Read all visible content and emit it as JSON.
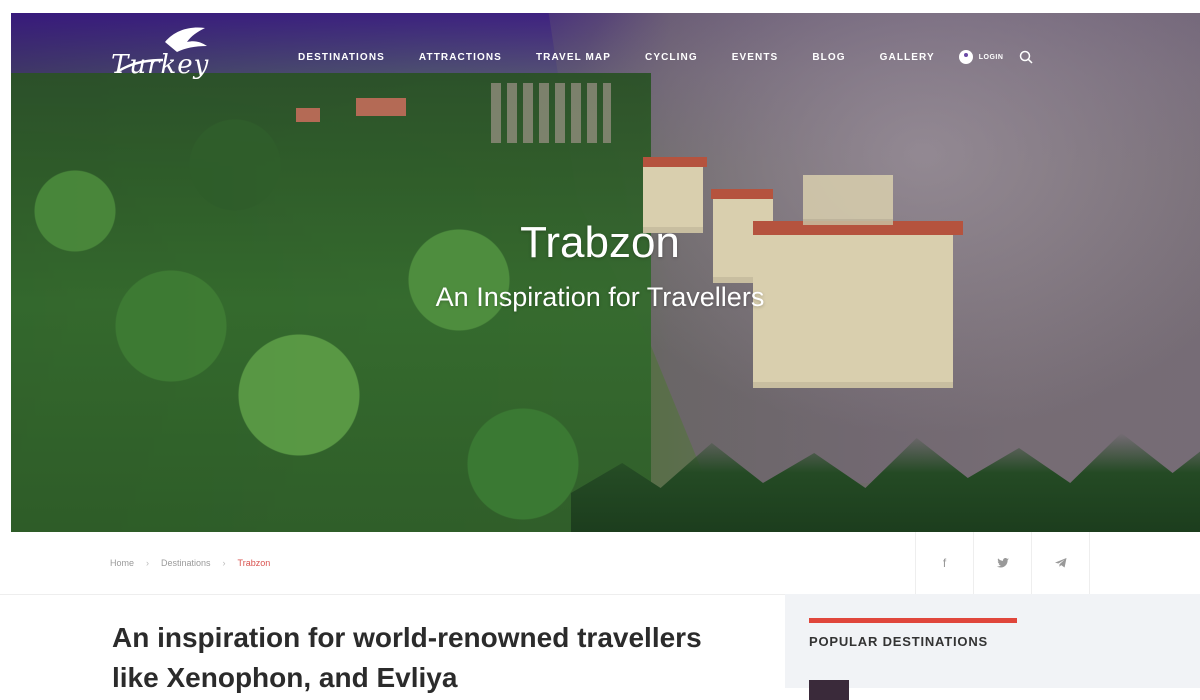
{
  "header": {
    "logo_text": "Turkey",
    "nav": [
      "DESTINATIONS",
      "ATTRACTIONS",
      "TRAVEL MAP",
      "CYCLING",
      "EVENTS",
      "BLOG",
      "GALLERY"
    ],
    "login_label": "LOGIN"
  },
  "hero": {
    "title": "Trabzon",
    "subtitle": "An Inspiration for Travellers"
  },
  "breadcrumb": {
    "items": [
      "Home",
      "Destinations",
      "Trabzon"
    ]
  },
  "share": {
    "facebook": "f",
    "twitter": "🐦",
    "telegram": "➤"
  },
  "article": {
    "title": "An inspiration for world-renowned travellers like Xenophon, and Evliya"
  },
  "sidebar": {
    "title": "POPULAR DESTINATIONS"
  },
  "colors": {
    "accent": "#e0463b",
    "breadcrumb_current": "#d9534f",
    "sidebar_bg": "#f1f3f6"
  }
}
